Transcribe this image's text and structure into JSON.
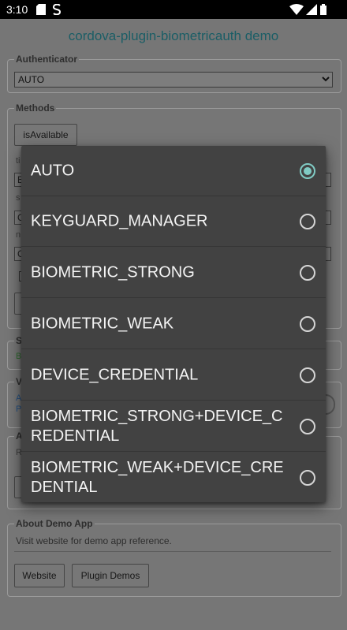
{
  "status_bar": {
    "time": "3:10",
    "left_icons": [
      "sd-card-icon",
      "s-app-icon"
    ],
    "right_icons": [
      "wifi-icon",
      "signal-icon",
      "battery-icon"
    ]
  },
  "app": {
    "title": "cordova-plugin-biometricauth demo",
    "authenticator": {
      "legend": "Authenticator",
      "selected": "AUTO"
    },
    "methods": {
      "legend": "Methods",
      "is_available_button": "isAvailable",
      "field_label_fragments": [
        "ti",
        "s",
        "n"
      ],
      "field_values": [
        "B",
        "C",
        "C"
      ],
      "button_fragment": ""
    },
    "partial_sections": {
      "s_legend": "S",
      "s_value": "B",
      "v_legend": "V",
      "v_lines": [
        "A",
        "P"
      ],
      "a_legend": "A",
      "a_text": "R"
    },
    "about": {
      "legend": "About Demo App",
      "text": "Visit website for demo app reference.",
      "website_button": "Website",
      "plugin_demos_button": "Plugin Demos"
    }
  },
  "dialog": {
    "options": [
      {
        "label": "AUTO",
        "checked": true
      },
      {
        "label": "KEYGUARD_MANAGER",
        "checked": false
      },
      {
        "label": "BIOMETRIC_STRONG",
        "checked": false
      },
      {
        "label": "BIOMETRIC_WEAK",
        "checked": false
      },
      {
        "label": "DEVICE_CREDENTIAL",
        "checked": false
      },
      {
        "label": "BIOMETRIC_STRONG+DEVICE_CREDENTIAL",
        "checked": false
      },
      {
        "label": "BIOMETRIC_WEAK+DEVICE_CREDENTIAL",
        "checked": false
      }
    ],
    "accent_color": "#80cbc4"
  }
}
